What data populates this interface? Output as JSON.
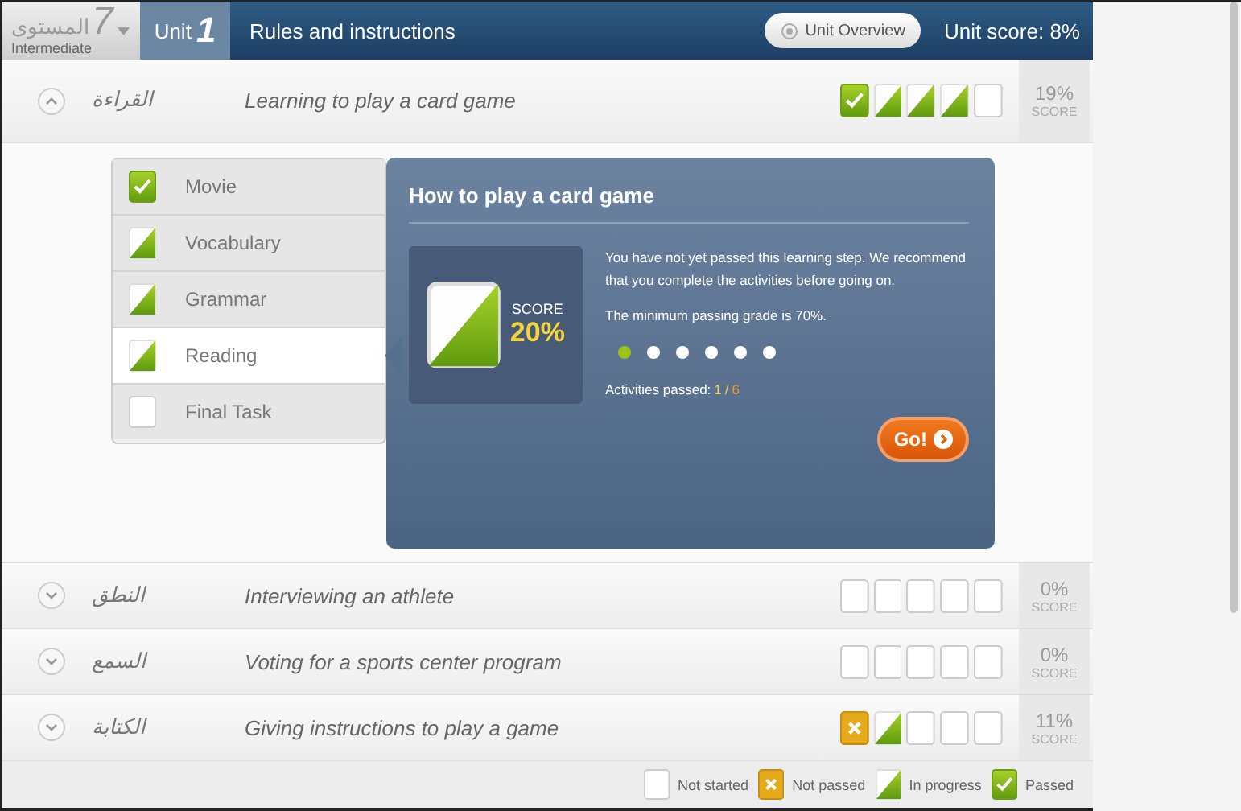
{
  "level": {
    "number": "7",
    "label": "المستوى",
    "name": "Intermediate"
  },
  "unit": {
    "label": "Unit",
    "number": "1",
    "title": "Rules and instructions",
    "overview_button": "Unit Overview",
    "score": "Unit score: 8%"
  },
  "lessons": [
    {
      "skill": "القراءة",
      "title": "Learning to play a card game",
      "expanded": true,
      "steps": [
        {
          "kind": "passed"
        },
        {
          "kind": "progress"
        },
        {
          "kind": "progress"
        },
        {
          "kind": "progress"
        },
        {
          "kind": "blank"
        }
      ],
      "score": "19%",
      "score_label": "SCORE"
    },
    {
      "skill": "النطق",
      "title": "Interviewing an athlete",
      "expanded": false,
      "steps": [
        {
          "kind": "blank"
        },
        {
          "kind": "blank"
        },
        {
          "kind": "blank"
        },
        {
          "kind": "blank"
        },
        {
          "kind": "blank"
        }
      ],
      "score": "0%",
      "score_label": "SCORE"
    },
    {
      "skill": "السمع",
      "title": "Voting for a sports center program",
      "expanded": false,
      "steps": [
        {
          "kind": "blank"
        },
        {
          "kind": "blank"
        },
        {
          "kind": "blank"
        },
        {
          "kind": "blank"
        },
        {
          "kind": "blank"
        }
      ],
      "score": "0%",
      "score_label": "SCORE"
    },
    {
      "skill": "الكتابة",
      "title": "Giving instructions to play a game",
      "expanded": false,
      "steps": [
        {
          "kind": "failed"
        },
        {
          "kind": "progress"
        },
        {
          "kind": "blank"
        },
        {
          "kind": "blank"
        },
        {
          "kind": "blank"
        }
      ],
      "score": "11%",
      "score_label": "SCORE"
    }
  ],
  "steps": [
    {
      "label": "Movie",
      "kind": "passed",
      "selected": false
    },
    {
      "label": "Vocabulary",
      "kind": "progress",
      "selected": false
    },
    {
      "label": "Grammar",
      "kind": "progress",
      "selected": false
    },
    {
      "label": "Reading",
      "kind": "progress",
      "selected": true
    },
    {
      "label": "Final Task",
      "kind": "blank",
      "selected": false
    }
  ],
  "detail": {
    "title": "How to play a card game",
    "score_label": "SCORE",
    "score": "20%",
    "message": "You have not yet passed this learning step. We recommend that you complete the activities before going on.",
    "minimum": "The minimum passing grade is 70%.",
    "activities": [
      {
        "done": true
      },
      {
        "done": false
      },
      {
        "done": false
      },
      {
        "done": false
      },
      {
        "done": false
      },
      {
        "done": false
      }
    ],
    "activities_label": "Activities passed:",
    "passed": "1",
    "separator": "/",
    "total": "6",
    "go_button": "Go!"
  },
  "legend": [
    {
      "kind": "blank",
      "label": "Not started"
    },
    {
      "kind": "failed",
      "label": "Not passed"
    },
    {
      "kind": "progress",
      "label": "In progress"
    },
    {
      "kind": "passed",
      "label": "Passed"
    }
  ]
}
